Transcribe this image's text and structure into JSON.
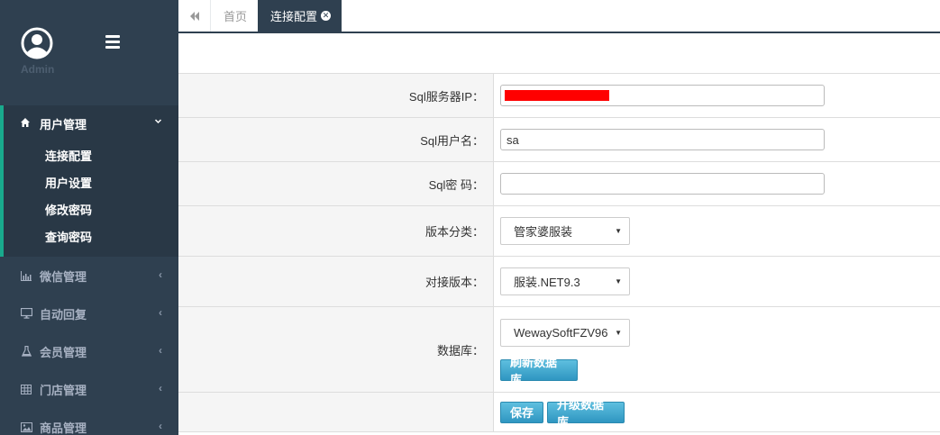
{
  "sidebar": {
    "user_name": "Admin",
    "active_group": {
      "label": "用户管理",
      "icon": "home-icon",
      "items": [
        {
          "label": "连接配置"
        },
        {
          "label": "用户设置"
        },
        {
          "label": "修改密码"
        },
        {
          "label": "查询密码"
        }
      ]
    },
    "groups": [
      {
        "label": "微信管理",
        "icon": "bar-chart-icon"
      },
      {
        "label": "自动回复",
        "icon": "monitor-icon"
      },
      {
        "label": "会员管理",
        "icon": "flask-icon"
      },
      {
        "label": "门店管理",
        "icon": "table-icon"
      },
      {
        "label": "商品管理",
        "icon": "picture-icon"
      }
    ]
  },
  "tabs": {
    "home_label": "首页",
    "active_label": "连接配置"
  },
  "form": {
    "server_ip_label": "Sql服务器IP：",
    "username_label": "Sql用户名：",
    "username_value": "sa",
    "password_label": "Sql密 码：",
    "password_value": "",
    "version_category_label": "版本分类：",
    "version_category_value": "管家婆服装",
    "target_version_label": "对接版本：",
    "target_version_value": "服装.NET9.3",
    "database_label": "数据库：",
    "database_value": "WewaySoftFZV96",
    "refresh_button": "刷新数据库",
    "save_button": "保存",
    "upgrade_button": "升级数据库"
  },
  "colors": {
    "sidebar_bg": "#2f4050",
    "accent": "#19aa8d",
    "button": "#2f96c1"
  }
}
